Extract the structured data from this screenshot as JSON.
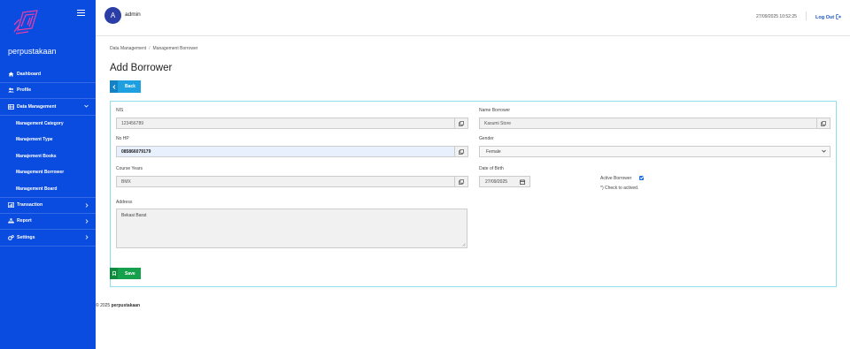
{
  "sidebar": {
    "brand": "perpustakaan",
    "items": [
      {
        "label": "Dashboard",
        "icon": "home-icon"
      },
      {
        "label": "Profile",
        "icon": "users-icon"
      },
      {
        "label": "Data Management",
        "icon": "database-icon"
      },
      {
        "label": "Transaction",
        "icon": "chart-icon"
      },
      {
        "label": "Report",
        "icon": "sitemap-icon"
      },
      {
        "label": "Settings",
        "icon": "gears-icon"
      }
    ],
    "subitems": [
      "Management Category",
      "Manajement Type",
      "Manajement Books",
      "Management Borrower",
      "Management Board"
    ]
  },
  "topbar": {
    "avatar_letter": "A",
    "username": "admin",
    "datetime": "27/09/2025 10:52:25",
    "logout": "Log Out"
  },
  "breadcrumb": {
    "parent": "Data Management",
    "separator": "/",
    "current": "Management Borrower"
  },
  "page_title": "Add Borrower",
  "back_label": "Back",
  "form": {
    "nis_label": "NIS",
    "nis_value": "123456789",
    "name_label": "Name Borrower",
    "name_value": "Kasumi Store",
    "hp_label": "No HP",
    "hp_value": "085866079179",
    "gender_label": "Gender",
    "gender_value": "Female",
    "course_label": "Course Years",
    "course_value": "BMX",
    "dob_label": "Date of Birth",
    "dob_value": "27/09/2025",
    "active_label": "Active Borrower",
    "active_checked": true,
    "active_hint": "*) Check to actived.",
    "address_label": "Address",
    "address_value": "Bekasi Barat"
  },
  "save_label": "Save",
  "footer": {
    "copy": "© 2025",
    "brand": "perpustakaan"
  },
  "colors": {
    "sidebar": "#0a4be0",
    "back": "#1ea0e0",
    "save": "#15a04b",
    "card_border": "#8fe0ea"
  }
}
